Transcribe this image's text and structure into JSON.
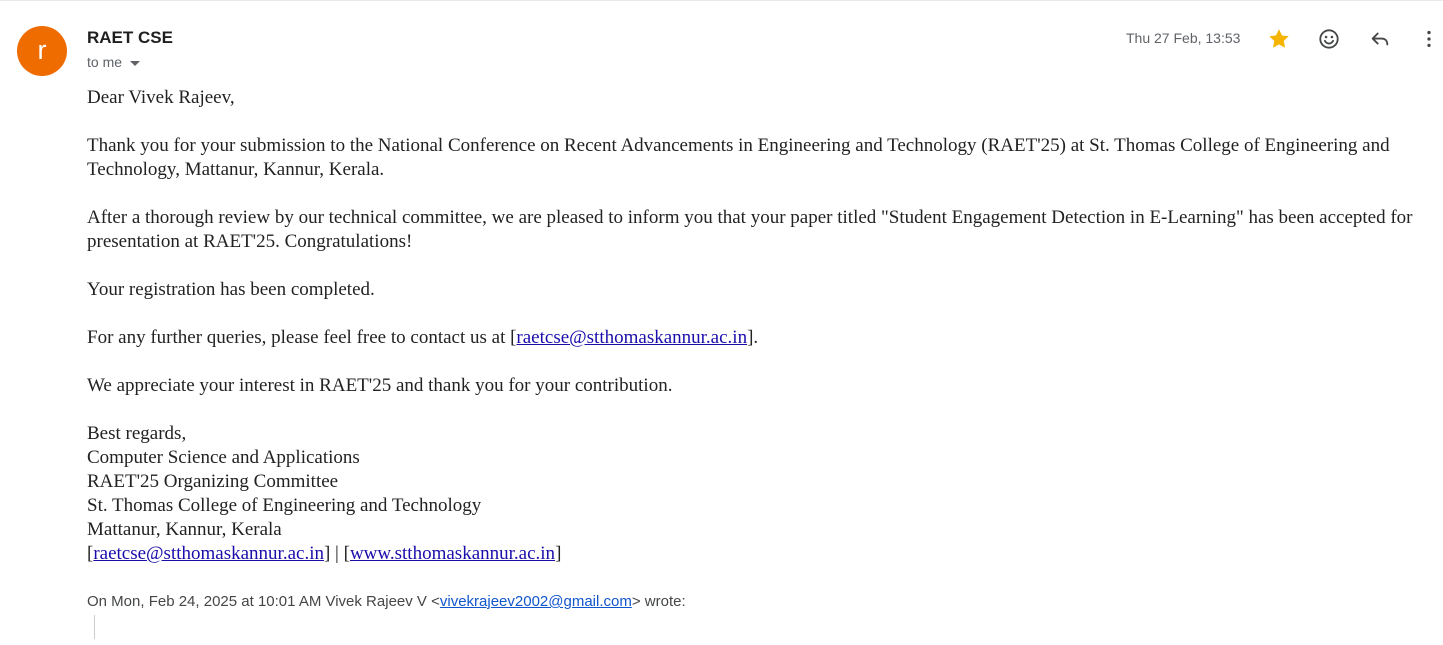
{
  "sender": {
    "avatar_letter": "r",
    "avatar_color": "#ef6c00",
    "name": "RAET CSE",
    "recipient": "to me",
    "timestamp": "Thu 27 Feb, 13:53"
  },
  "actions": {
    "star_icon": "star-icon",
    "star_color": "#f4b400",
    "emoji_icon": "emoji-reaction-icon",
    "reply_icon": "reply-icon",
    "more_icon": "more-vert-icon"
  },
  "body": {
    "greeting": "Dear Vivek Rajeev,",
    "para1": "Thank you for your submission to the National Conference on Recent Advancements in Engineering and Technology (RAET'25) at St. Thomas College of Engineering and Technology, Mattanur, Kannur, Kerala.",
    "para2": "After a thorough review by our technical committee, we are pleased to inform you that your paper titled \"Student Engagement Detection in E-Learning\" has been accepted for presentation at RAET'25. Congratulations!",
    "para3": "Your registration has been completed.",
    "para4_prefix": "For any further queries, please feel free to contact us at [",
    "para4_link": "raetcse@stthomaskannur.ac.in",
    "para4_suffix": "].",
    "para5": "We appreciate your interest in RAET'25 and thank you for your contribution."
  },
  "signature": {
    "line1": "Best regards,",
    "line2": "Computer Science and Applications",
    "line3": "RAET'25 Organizing Committee",
    "line4": "St. Thomas College of Engineering and Technology",
    "line5": "Mattanur, Kannur, Kerala",
    "open_bracket": "[",
    "email_link": "raetcse@stthomaskannur.ac.in",
    "separator": "] | [",
    "web_link": "www.stthomaskannur.ac.in",
    "close_bracket": "]"
  },
  "quote": {
    "prefix": "On Mon, Feb 24, 2025 at 10:01 AM Vivek Rajeev V <",
    "email": "vivekrajeev2002@gmail.com",
    "suffix": "> wrote:"
  }
}
